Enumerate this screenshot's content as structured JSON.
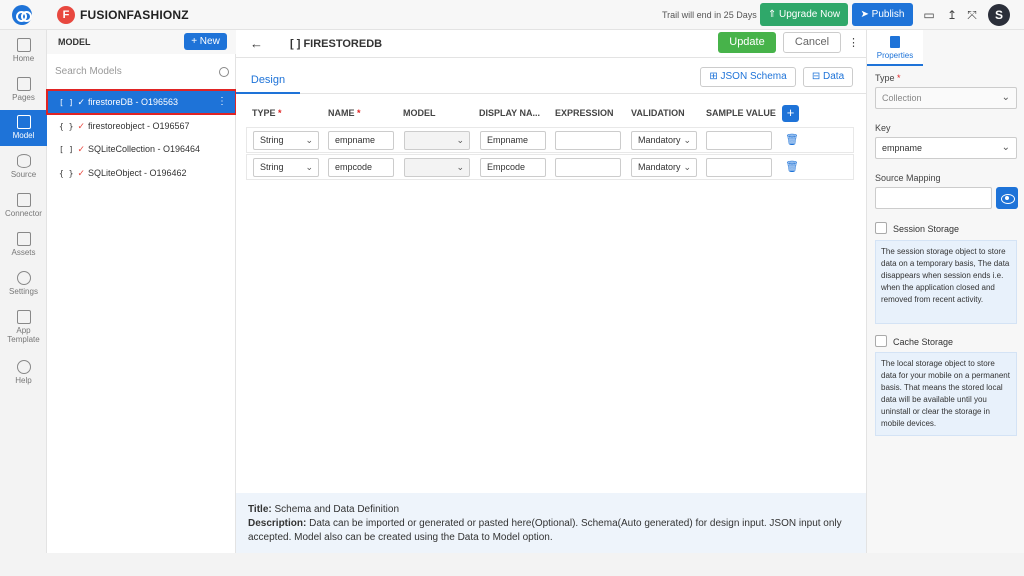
{
  "topbar": {
    "brand_letter": "F",
    "brand_name": "FUSIONFASHIONZ",
    "trail_text": "Trail will end in 25 Days",
    "upgrade_label": "Upgrade Now",
    "publish_label": "Publish",
    "avatar_letter": "S"
  },
  "leftnav": {
    "items": [
      {
        "label": "Home",
        "icon": "home-icon"
      },
      {
        "label": "Pages",
        "icon": "pages-icon"
      },
      {
        "label": "Model",
        "icon": "model-icon"
      },
      {
        "label": "Source",
        "icon": "source-icon"
      },
      {
        "label": "Connector",
        "icon": "connector-icon"
      },
      {
        "label": "Assets",
        "icon": "assets-icon"
      },
      {
        "label": "Settings",
        "icon": "settings-icon"
      },
      {
        "label": "App",
        "label2": "Template",
        "icon": "app-template-icon"
      },
      {
        "label": "Help",
        "icon": "help-icon"
      }
    ]
  },
  "model_panel": {
    "title": "MODEL",
    "new_label": "+ New",
    "search_placeholder": "Search Models",
    "items": [
      {
        "bracket": "[ ]",
        "name": "firestoreDB - O196563"
      },
      {
        "bracket": "{ }",
        "name": "firestoreobject - O196567"
      },
      {
        "bracket": "[ ]",
        "name": "SQLiteCollection - O196464"
      },
      {
        "bracket": "{ }",
        "name": "SQLiteObject - O196462"
      }
    ]
  },
  "main": {
    "title_bracket": "[ ]",
    "title": "FIRESTOREDB",
    "update_label": "Update",
    "cancel_label": "Cancel",
    "tab_design": "Design",
    "json_schema_label": "JSON Schema",
    "data_label": "Data",
    "columns": [
      "TYPE",
      "NAME",
      "MODEL",
      "DISPLAY NA...",
      "EXPRESSION",
      "VALIDATION",
      "SAMPLE VALUE"
    ],
    "rows": [
      {
        "type": "String",
        "name": "empname",
        "model": "",
        "display": "Empname",
        "expression": "",
        "validation": "Mandatory",
        "sample": ""
      },
      {
        "type": "String",
        "name": "empcode",
        "model": "",
        "display": "Empcode",
        "expression": "",
        "validation": "Mandatory",
        "sample": ""
      }
    ],
    "footer": {
      "title_label": "Title:",
      "title_text": "Schema and Data Definition",
      "desc_label": "Description:",
      "desc_text": "Data can be imported or generated or pasted here(Optional). Schema(Auto generated) for design input. JSON input only accepted. Model also can be created using the Data to Model option."
    }
  },
  "right_panel": {
    "tab_label": "Properties",
    "type_label": "Type",
    "type_value": "Collection",
    "key_label": "Key",
    "key_value": "empname",
    "source_mapping_label": "Source Mapping",
    "session_label": "Session Storage",
    "session_note": "The session storage object to store data on a temporary basis, The data disappears when session ends i.e. when the application closed and removed from recent activity.",
    "cache_label": "Cache Storage",
    "cache_note": "The local storage object to store data for your mobile on a permanent basis. That means the stored local data will be available until you uninstall or clear the storage in mobile devices."
  }
}
